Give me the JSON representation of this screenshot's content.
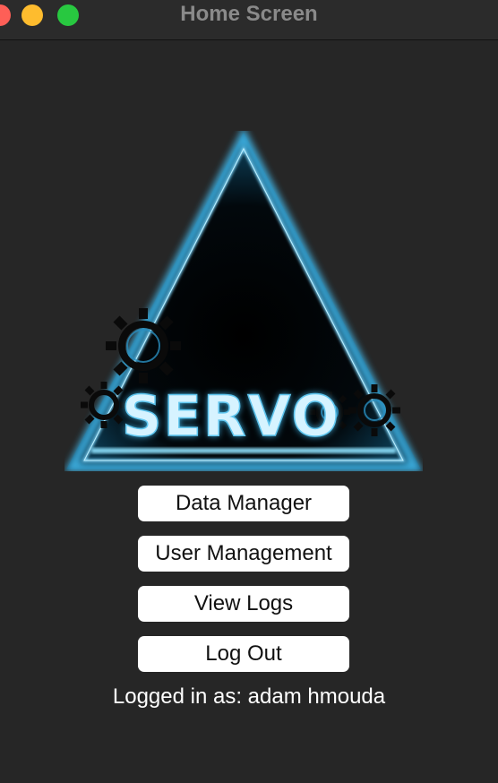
{
  "window": {
    "title": "Home Screen"
  },
  "logo": {
    "wordmark": "SERVO",
    "colors": {
      "glow": "#3fb6e8",
      "text": "#cfefff",
      "inner": "#000000"
    }
  },
  "buttons": {
    "data_manager": "Data Manager",
    "user_management": "User Management",
    "view_logs": "View Logs",
    "log_out": "Log Out"
  },
  "status": {
    "logged_in_text": "Logged in as: adam hmouda"
  },
  "colors": {
    "background": "#262626",
    "button_bg": "#ffffff",
    "close": "#fe5f57",
    "minimize": "#febc2e",
    "maximize": "#28c840"
  }
}
